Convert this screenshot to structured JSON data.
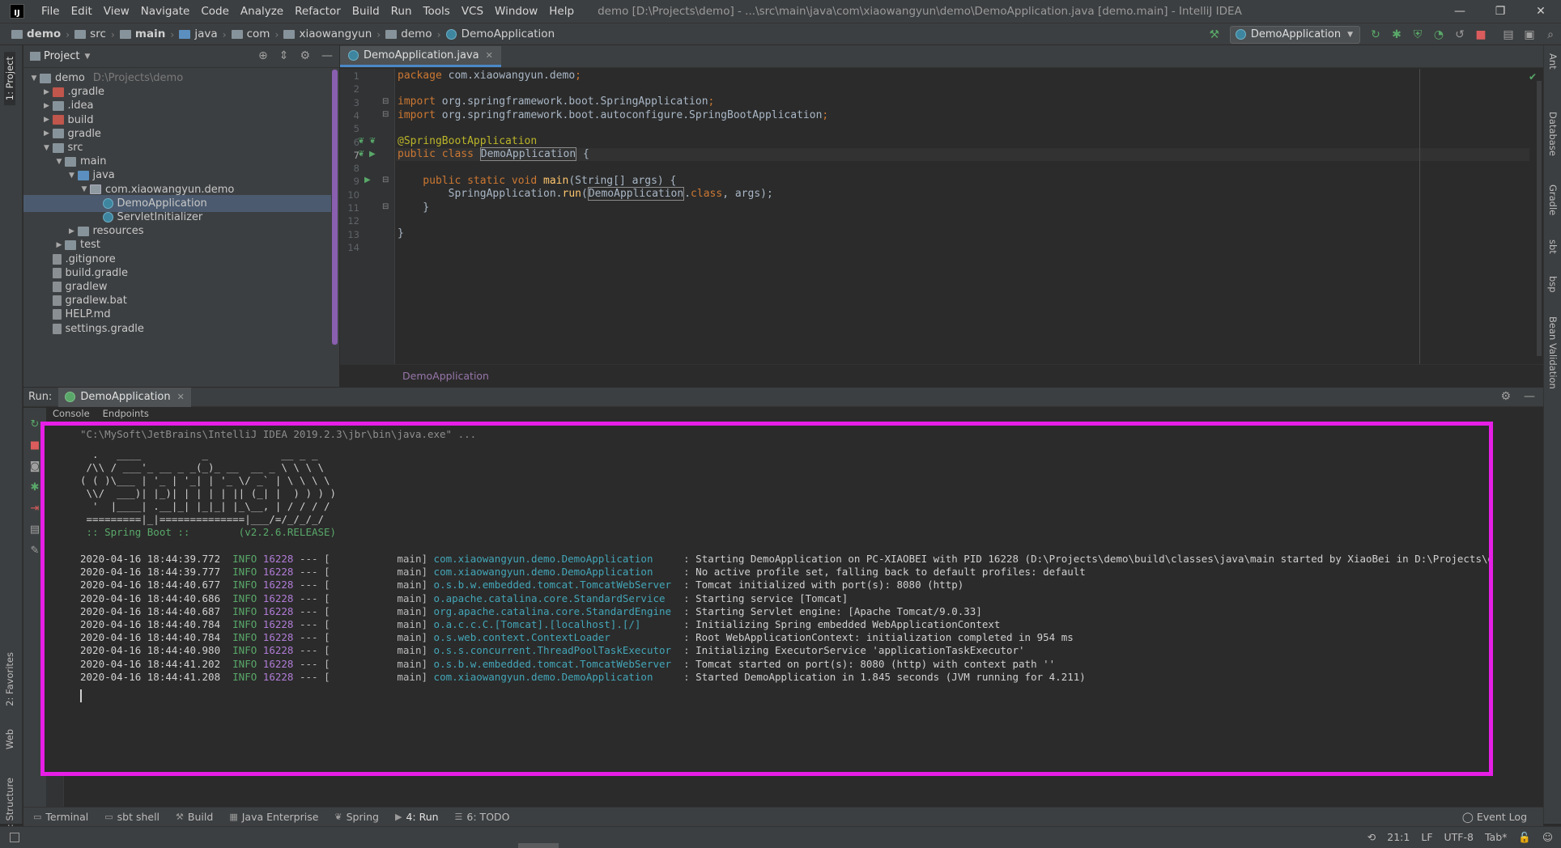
{
  "window": {
    "title": "demo [D:\\Projects\\demo] - ...\\src\\main\\java\\com\\xiaowangyun\\demo\\DemoApplication.java [demo.main] - IntelliJ IDEA",
    "menu": [
      "File",
      "Edit",
      "View",
      "Navigate",
      "Code",
      "Analyze",
      "Refactor",
      "Build",
      "Run",
      "Tools",
      "VCS",
      "Window",
      "Help"
    ]
  },
  "breadcrumb": [
    "demo",
    "src",
    "main",
    "java",
    "com",
    "xiaowangyun",
    "demo",
    "DemoApplication"
  ],
  "run_config": {
    "label": "DemoApplication"
  },
  "left_strip": {
    "project_tab": "1: Project",
    "favorites_tab": "2: Favorites",
    "web_tab": "Web",
    "structure_tab": "Z: Structure"
  },
  "right_strip": [
    "Ant",
    "Database",
    "Gradle",
    "sbt",
    "bsp",
    "Bean Validation"
  ],
  "project_panel": {
    "title": "Project",
    "tree": [
      {
        "label": "demo",
        "hint": "D:\\Projects\\demo",
        "depth": 0,
        "arrow": "open",
        "icon": "folder"
      },
      {
        "label": ".gradle",
        "depth": 1,
        "arrow": "closed",
        "icon": "folder-red"
      },
      {
        "label": ".idea",
        "depth": 1,
        "arrow": "closed",
        "icon": "folder"
      },
      {
        "label": "build",
        "depth": 1,
        "arrow": "closed",
        "icon": "folder-red"
      },
      {
        "label": "gradle",
        "depth": 1,
        "arrow": "closed",
        "icon": "folder"
      },
      {
        "label": "src",
        "depth": 1,
        "arrow": "open",
        "icon": "folder"
      },
      {
        "label": "main",
        "depth": 2,
        "arrow": "open",
        "icon": "folder"
      },
      {
        "label": "java",
        "depth": 3,
        "arrow": "open",
        "icon": "folder-blue"
      },
      {
        "label": "com.xiaowangyun.demo",
        "depth": 4,
        "arrow": "open",
        "icon": "folder-pkg"
      },
      {
        "label": "DemoApplication",
        "depth": 5,
        "arrow": "none",
        "icon": "class",
        "selected": true
      },
      {
        "label": "ServletInitializer",
        "depth": 5,
        "arrow": "none",
        "icon": "class"
      },
      {
        "label": "resources",
        "depth": 3,
        "arrow": "closed",
        "icon": "folder"
      },
      {
        "label": "test",
        "depth": 2,
        "arrow": "closed",
        "icon": "folder"
      },
      {
        "label": ".gitignore",
        "depth": 1,
        "arrow": "none",
        "icon": "file"
      },
      {
        "label": "build.gradle",
        "depth": 1,
        "arrow": "none",
        "icon": "file"
      },
      {
        "label": "gradlew",
        "depth": 1,
        "arrow": "none",
        "icon": "file"
      },
      {
        "label": "gradlew.bat",
        "depth": 1,
        "arrow": "none",
        "icon": "file"
      },
      {
        "label": "HELP.md",
        "depth": 1,
        "arrow": "none",
        "icon": "file"
      },
      {
        "label": "settings.gradle",
        "depth": 1,
        "arrow": "none",
        "icon": "file"
      }
    ]
  },
  "editor": {
    "tab_label": "DemoApplication.java",
    "current_line": 7,
    "breadcrumb": "DemoApplication",
    "lines": [
      [
        {
          "t": "package ",
          "c": "kw"
        },
        {
          "t": "com.xiaowangyun.demo",
          "c": "pkg"
        },
        {
          "t": ";",
          "c": "kw"
        }
      ],
      [],
      [
        {
          "t": "import ",
          "c": "kw"
        },
        {
          "t": "org.springframework.boot.SpringApplication",
          "c": "pkg"
        },
        {
          "t": ";",
          "c": "kw"
        }
      ],
      [
        {
          "t": "import ",
          "c": "kw"
        },
        {
          "t": "org.springframework.boot.autoconfigure.SpringBootApplication",
          "c": "pkg"
        },
        {
          "t": ";",
          "c": "kw"
        }
      ],
      [],
      [
        {
          "t": "@SpringBootApplication",
          "c": "ann"
        }
      ],
      [
        {
          "t": "public class ",
          "c": "kw"
        },
        {
          "t": "DemoApplication",
          "c": "cls",
          "box": true
        },
        {
          "t": " {",
          "c": "pkg"
        }
      ],
      [],
      [
        {
          "t": "    public static void ",
          "c": "kw"
        },
        {
          "t": "main",
          "c": "fn"
        },
        {
          "t": "(String[] args) {",
          "c": "pkg"
        }
      ],
      [
        {
          "t": "        SpringApplication.",
          "c": "pkg"
        },
        {
          "t": "run",
          "c": "fn"
        },
        {
          "t": "(",
          "c": "pkg"
        },
        {
          "t": "DemoApplication",
          "c": "cls",
          "box": true
        },
        {
          "t": ".",
          "c": "pkg"
        },
        {
          "t": "class",
          "c": "kw"
        },
        {
          "t": ", args);",
          "c": "pkg"
        }
      ],
      [
        {
          "t": "    }",
          "c": "pkg"
        }
      ],
      [],
      [
        {
          "t": "}",
          "c": "pkg"
        }
      ],
      []
    ]
  },
  "run_panel": {
    "label": "Run:",
    "tab_label": "DemoApplication",
    "subtabs": [
      "Console",
      "Endpoints"
    ],
    "command": "\"C:\\MySoft\\JetBrains\\IntelliJ IDEA 2019.2.3\\jbr\\bin\\java.exe\" ...",
    "banner": [
      "  .   ____          _            __ _ _",
      " /\\\\ / ___'_ __ _ _(_)_ __  __ _ \\ \\ \\ \\",
      "( ( )\\___ | '_ | '_| | '_ \\/ _` | \\ \\ \\ \\",
      " \\\\/  ___)| |_)| | | | | || (_| |  ) ) ) )",
      "  '  |____| .__|_| |_|_| |_\\__, | / / / /",
      " =========|_|==============|___/=/_/_/_/"
    ],
    "spring_boot": " :: Spring Boot ::        (v2.2.6.RELEASE)",
    "logs": [
      {
        "ts": "2020-04-16 18:44:39.772",
        "level": "INFO",
        "pid": "16228",
        "thread": "main",
        "logger": "com.xiaowangyun.demo.DemoApplication",
        "msg": "Starting DemoApplication on PC-XIAOBEI with PID 16228 (D:\\Projects\\demo\\build\\classes\\java\\main started by XiaoBei in D:\\Projects\\demo)"
      },
      {
        "ts": "2020-04-16 18:44:39.777",
        "level": "INFO",
        "pid": "16228",
        "thread": "main",
        "logger": "com.xiaowangyun.demo.DemoApplication",
        "msg": "No active profile set, falling back to default profiles: default"
      },
      {
        "ts": "2020-04-16 18:44:40.677",
        "level": "INFO",
        "pid": "16228",
        "thread": "main",
        "logger": "o.s.b.w.embedded.tomcat.TomcatWebServer",
        "msg": "Tomcat initialized with port(s): 8080 (http)"
      },
      {
        "ts": "2020-04-16 18:44:40.686",
        "level": "INFO",
        "pid": "16228",
        "thread": "main",
        "logger": "o.apache.catalina.core.StandardService",
        "msg": "Starting service [Tomcat]"
      },
      {
        "ts": "2020-04-16 18:44:40.687",
        "level": "INFO",
        "pid": "16228",
        "thread": "main",
        "logger": "org.apache.catalina.core.StandardEngine",
        "msg": "Starting Servlet engine: [Apache Tomcat/9.0.33]"
      },
      {
        "ts": "2020-04-16 18:44:40.784",
        "level": "INFO",
        "pid": "16228",
        "thread": "main",
        "logger": "o.a.c.c.C.[Tomcat].[localhost].[/]",
        "msg": "Initializing Spring embedded WebApplicationContext"
      },
      {
        "ts": "2020-04-16 18:44:40.784",
        "level": "INFO",
        "pid": "16228",
        "thread": "main",
        "logger": "o.s.web.context.ContextLoader",
        "msg": "Root WebApplicationContext: initialization completed in 954 ms"
      },
      {
        "ts": "2020-04-16 18:44:40.980",
        "level": "INFO",
        "pid": "16228",
        "thread": "main",
        "logger": "o.s.s.concurrent.ThreadPoolTaskExecutor",
        "msg": "Initializing ExecutorService 'applicationTaskExecutor'"
      },
      {
        "ts": "2020-04-16 18:44:41.202",
        "level": "INFO",
        "pid": "16228",
        "thread": "main",
        "logger": "o.s.b.w.embedded.tomcat.TomcatWebServer",
        "msg": "Tomcat started on port(s): 8080 (http) with context path ''"
      },
      {
        "ts": "2020-04-16 18:44:41.208",
        "level": "INFO",
        "pid": "16228",
        "thread": "main",
        "logger": "com.xiaowangyun.demo.DemoApplication",
        "msg": "Started DemoApplication in 1.845 seconds (JVM running for 4.211)"
      }
    ]
  },
  "bottom_tabs": [
    {
      "label": "Terminal",
      "icon": "terminal-icon",
      "glyph": "▭"
    },
    {
      "label": "sbt shell",
      "icon": "sbt-icon",
      "glyph": "▭"
    },
    {
      "label": "Build",
      "icon": "hammer-icon",
      "glyph": "⚒"
    },
    {
      "label": "Java Enterprise",
      "icon": "java-ee-icon",
      "glyph": "▦"
    },
    {
      "label": "Spring",
      "icon": "spring-icon",
      "glyph": "❦"
    },
    {
      "label": "4: Run",
      "icon": "run-icon",
      "glyph": "▶",
      "active": true
    },
    {
      "label": "6: TODO",
      "icon": "todo-icon",
      "glyph": "☰"
    }
  ],
  "event_log": "Event Log",
  "status": {
    "position": "21:1",
    "line_sep": "LF",
    "encoding": "UTF-8",
    "indent": "Tab*"
  },
  "colors": {
    "accent": "#4a88c7",
    "console_highlight": "#e61ee6",
    "selection": "#4b5a6e"
  }
}
